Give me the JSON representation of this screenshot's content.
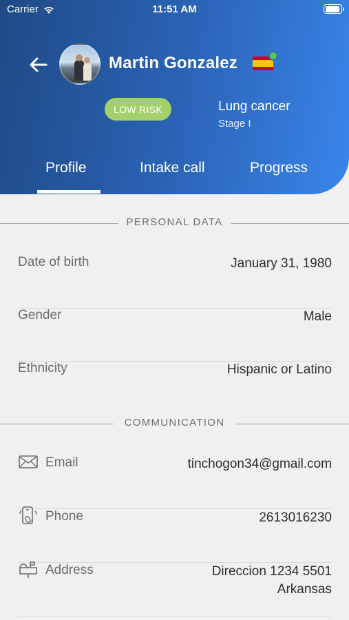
{
  "status_bar": {
    "carrier": "Carrier",
    "time": "11:51 AM"
  },
  "header": {
    "patient_name": "Martin Gonzalez",
    "risk_badge": "LOW RISK",
    "diagnosis": "Lung cancer",
    "stage": "Stage I",
    "colors": {
      "gradient_start": "#1f4a86",
      "gradient_end": "#3a85ea",
      "risk_badge": "#a3d06a",
      "online": "#57c84d"
    }
  },
  "tabs": [
    {
      "label": "Profile",
      "active": true
    },
    {
      "label": "Intake call",
      "active": false
    },
    {
      "label": "Progress",
      "active": false
    }
  ],
  "personal_data": {
    "title": "PERSONAL DATA",
    "rows": [
      {
        "label": "Date of birth",
        "value": "January 31, 1980"
      },
      {
        "label": "Gender",
        "value": "Male"
      },
      {
        "label": "Ethnicity",
        "value": "Hispanic or Latino"
      }
    ]
  },
  "communication": {
    "title": "COMMUNICATION",
    "rows": [
      {
        "icon": "envelope-icon",
        "label": "Email",
        "value": "tinchogon34@gmail.com"
      },
      {
        "icon": "phone-icon",
        "label": "Phone",
        "value": "2613016230"
      },
      {
        "icon": "mailbox-icon",
        "label": "Address",
        "value_line1": "Direccion 1234 5501",
        "value_line2": "Arkansas"
      }
    ]
  }
}
